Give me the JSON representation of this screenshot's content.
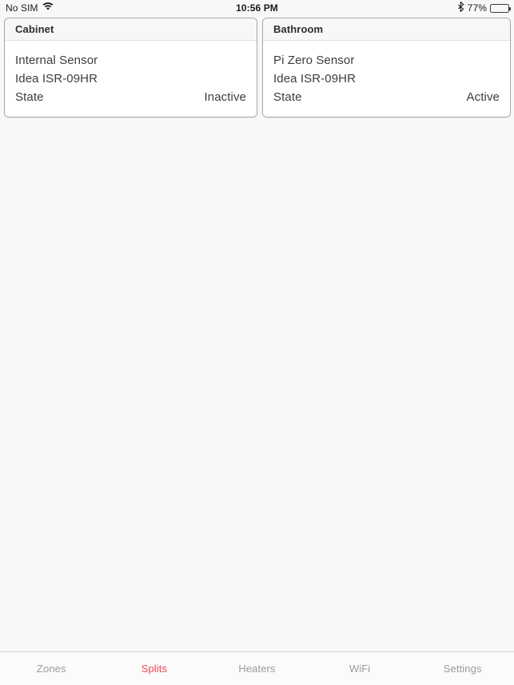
{
  "status_bar": {
    "carrier": "No SIM",
    "wifi_icon": "wifi-icon",
    "time": "10:56 PM",
    "bluetooth_icon": "bluetooth-icon",
    "battery_percent": "77%",
    "battery_icon": "battery-icon",
    "battery_level": 77
  },
  "colors": {
    "accent": "#e8484c",
    "inactive_tab": "#9b9b9b",
    "page_background": "#f8f8f8",
    "card_background": "#ffffff",
    "card_border": "#a8a8a8",
    "card_header_background": "#f7f7f7"
  },
  "main": {
    "cards": [
      {
        "title": "Cabinet",
        "device_name": "Internal Sensor",
        "model": "Idea ISR-09HR",
        "state_label": "State",
        "state_value": "Inactive"
      },
      {
        "title": "Bathroom",
        "device_name": "Pi Zero Sensor",
        "model": "Idea ISR-09HR",
        "state_label": "State",
        "state_value": "Active"
      }
    ]
  },
  "tab_bar": {
    "items": [
      {
        "label": "Zones",
        "active": false
      },
      {
        "label": "Splits",
        "active": true
      },
      {
        "label": "Heaters",
        "active": false
      },
      {
        "label": "WiFi",
        "active": false
      },
      {
        "label": "Settings",
        "active": false
      }
    ]
  }
}
